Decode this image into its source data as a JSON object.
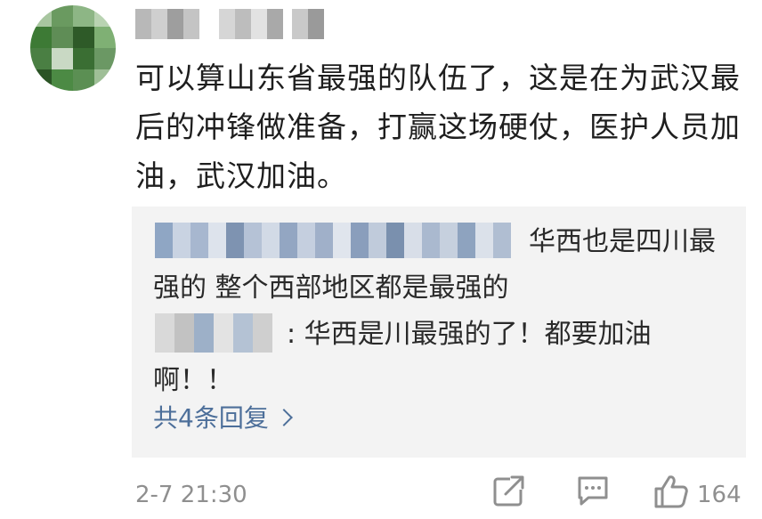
{
  "comment": {
    "text": "可以算山东省最强的队伍了，这是在为武汉最后的冲锋做准备，打赢这场硬仗，医护人员加油，武汉加油。"
  },
  "replies": [
    {
      "text": "华西也是四川最强的 整个西部地区都是最强的"
    },
    {
      "text": ": 华西是川最强的了！都要加油啊！！"
    }
  ],
  "more_replies_label": "共4条回复",
  "footer": {
    "timestamp": "2-7 21:30",
    "like_count": "164"
  },
  "icons": {
    "share": "share-icon",
    "comment": "comment-icon",
    "like": "thumbs-up-icon",
    "more": "chevron-right-icon"
  }
}
